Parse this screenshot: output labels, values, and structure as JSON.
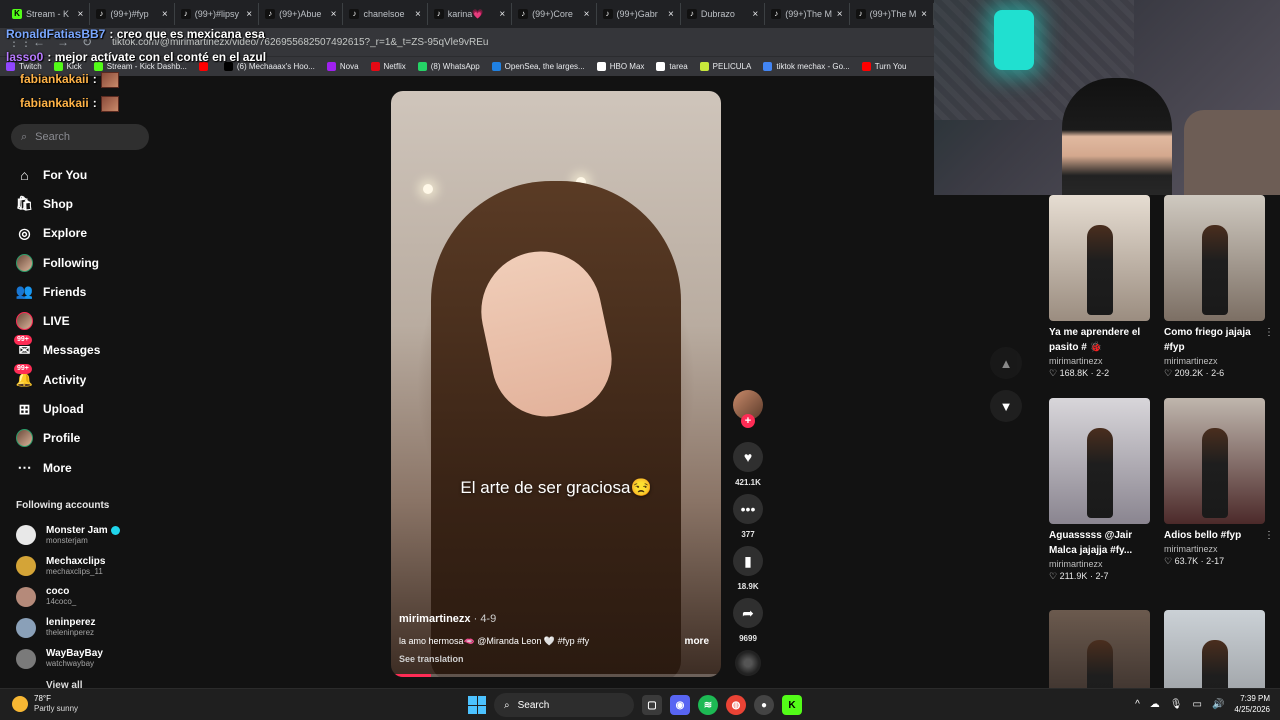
{
  "browser": {
    "tabs": [
      {
        "label": "Stream - K",
        "icon_color": "#53fc18"
      },
      {
        "label": "(99+)#fyp",
        "icon_color": "#111111"
      },
      {
        "label": "(99+)#lipsy",
        "icon_color": "#111111"
      },
      {
        "label": "(99+)Abue",
        "icon_color": "#111111"
      },
      {
        "label": "chanelsoe",
        "icon_color": "#111111"
      },
      {
        "label": "karina💗",
        "icon_color": "#111111"
      },
      {
        "label": "(99+)Core",
        "icon_color": "#111111"
      },
      {
        "label": "(99+)Gabr",
        "icon_color": "#111111"
      },
      {
        "label": "Dubrazo",
        "icon_color": "#111111"
      },
      {
        "label": "(99+)The M",
        "icon_color": "#111111"
      },
      {
        "label": "(99+)The M",
        "icon_color": "#111111"
      }
    ],
    "url": "tiktok.com/@mirimartinezx/video/7626955682507492615?_r=1&_t=ZS-95qVle9vREu",
    "bookmarks": [
      {
        "label": "Twitch",
        "color": "#9146ff"
      },
      {
        "label": "Kick",
        "color": "#53fc18"
      },
      {
        "label": "Stream - Kick Dashb...",
        "color": "#53fc18"
      },
      {
        "label": "",
        "color": "#ff0000"
      },
      {
        "label": "(6) Mechaaax's Hoo...",
        "color": "#000000"
      },
      {
        "label": "Nova",
        "color": "#a020f0"
      },
      {
        "label": "Netflix",
        "color": "#e50914"
      },
      {
        "label": "(8) WhatsApp",
        "color": "#25d366"
      },
      {
        "label": "OpenSea, the larges...",
        "color": "#2081e2"
      },
      {
        "label": "HBO Max",
        "color": "#ffffff"
      },
      {
        "label": "tarea",
        "color": "#ffffff"
      },
      {
        "label": "PELICULA",
        "color": "#c7e83b"
      },
      {
        "label": "tiktok mechax - Go...",
        "color": "#4285f4"
      },
      {
        "label": "Turn You",
        "color": "#ff0000"
      }
    ]
  },
  "chat": [
    {
      "user": "RonaldFatiasBB7",
      "color": "#7aa7ff",
      "message": ": creo que es mexicana esa"
    },
    {
      "user": "lasso0",
      "color": "#b77aff",
      "message": ": mejor actívate con el conté en el azul"
    },
    {
      "user": "fabiankakaii",
      "color": "#ffb347",
      "message": ":"
    },
    {
      "user": "fabiankakaii",
      "color": "#ffb347",
      "message": ":"
    }
  ],
  "sidebar": {
    "search_placeholder": "Search",
    "items": [
      {
        "label": "For You",
        "icon": "home-icon",
        "glyph": "⌂",
        "badge": ""
      },
      {
        "label": "Shop",
        "icon": "shopping-bag-icon",
        "glyph": "🛍",
        "badge": ""
      },
      {
        "label": "Explore",
        "icon": "compass-icon",
        "glyph": "◎",
        "badge": ""
      },
      {
        "label": "Following",
        "icon": "following-avatar-icon",
        "glyph": "",
        "badge": ""
      },
      {
        "label": "Friends",
        "icon": "friends-icon",
        "glyph": "👥",
        "badge": ""
      },
      {
        "label": "LIVE",
        "icon": "live-avatar-icon",
        "glyph": "",
        "badge": ""
      },
      {
        "label": "Messages",
        "icon": "messages-icon",
        "glyph": "✉",
        "badge": "99+"
      },
      {
        "label": "Activity",
        "icon": "activity-icon",
        "glyph": "🔔",
        "badge": "99+"
      },
      {
        "label": "Upload",
        "icon": "upload-icon",
        "glyph": "⊞",
        "badge": ""
      },
      {
        "label": "Profile",
        "icon": "profile-avatar-icon",
        "glyph": "",
        "badge": ""
      },
      {
        "label": "More",
        "icon": "more-icon",
        "glyph": "⋯",
        "badge": ""
      }
    ],
    "following_title": "Following accounts",
    "accounts": [
      {
        "name": "Monster Jam",
        "handle": "monsterjam",
        "verified": true,
        "color": "#e8e8e8"
      },
      {
        "name": "Mechaxclips",
        "handle": "mechaxclips_11",
        "verified": false,
        "color": "#d4a437"
      },
      {
        "name": "coco",
        "handle": "14coco_",
        "verified": false,
        "color": "#b58a7a"
      },
      {
        "name": "leninperez",
        "handle": "theleninperez",
        "verified": false,
        "color": "#8aa0b8"
      },
      {
        "name": "WayBayBay",
        "handle": "watchwaybay",
        "verified": false,
        "color": "#7a7a7a"
      }
    ],
    "view_all": "View all"
  },
  "video": {
    "caption": "El arte de ser graciosa😒",
    "author": "mirimartinezx",
    "date": "· 4-9",
    "description": "la amo hermosa🫦 @Miranda Leon 🤍 #fyp #fy",
    "more": "more",
    "translation": "See translation",
    "progress": 0.12,
    "accent": "#fe2c55"
  },
  "actions": {
    "follow": "+",
    "likes": "421.1K",
    "comments": "377",
    "saves": "18.9K",
    "shares": "9699"
  },
  "recommendations": [
    {
      "title": "Ya me aprendere el pasito # 🐞",
      "author": "mirimartinezx",
      "likes": "168.8K",
      "date": "2-2",
      "menu": ""
    },
    {
      "title": "Como friego jajaja #fyp",
      "author": "mirimartinezx",
      "likes": "209.2K",
      "date": "2-6",
      "menu": "⋮"
    },
    {
      "title": "Aguasssss @Jair Malca jajajja #fy...",
      "author": "mirimartinezx",
      "likes": "211.9K",
      "date": "2-7",
      "menu": ""
    },
    {
      "title": "Adios bello #fyp",
      "author": "mirimartinezx",
      "likes": "63.7K",
      "date": "2-17",
      "menu": "⋮"
    },
    {
      "title": "",
      "author": "",
      "likes": "",
      "date": "",
      "menu": ""
    },
    {
      "title": "",
      "author": "",
      "likes": "",
      "date": "",
      "menu": ""
    }
  ],
  "taskbar": {
    "temperature": "78°F",
    "weather": "Partly sunny",
    "search": "Search",
    "time": "7:39 PM",
    "date": "4/25/2026"
  }
}
